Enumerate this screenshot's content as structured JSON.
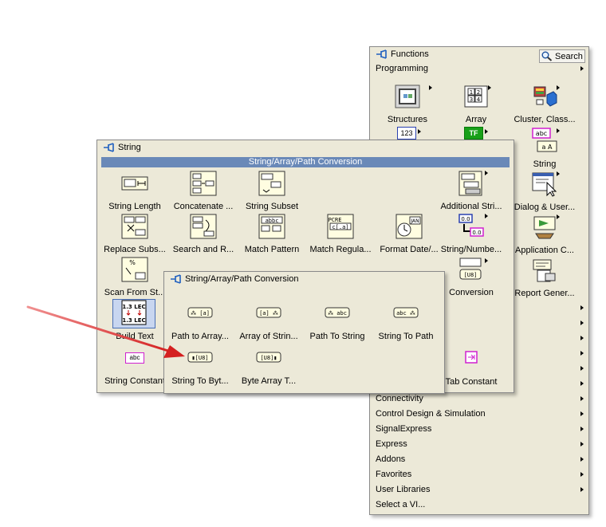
{
  "functions_palette": {
    "title": "Functions",
    "search_label": "Search",
    "category": "Programming",
    "icons": [
      {
        "label": "Structures"
      },
      {
        "label": "Array"
      },
      {
        "label": "Cluster, Class..."
      },
      {
        "label": "String"
      },
      {
        "label": "Dialog & User..."
      },
      {
        "label": "Application C..."
      },
      {
        "label": "Report Gener..."
      }
    ],
    "menu_items": [
      {
        "label": "Connectivity"
      },
      {
        "label": "Control Design & Simulation"
      },
      {
        "label": "SignalExpress"
      },
      {
        "label": "Express"
      },
      {
        "label": "Addons"
      },
      {
        "label": "Favorites"
      },
      {
        "label": "User Libraries"
      },
      {
        "label": "Select a VI..."
      }
    ]
  },
  "string_palette": {
    "title": "String",
    "section_header": "String/Array/Path Conversion",
    "icons": [
      {
        "label": "String Length"
      },
      {
        "label": "Concatenate ..."
      },
      {
        "label": "String Subset"
      },
      {
        "label": "Additional Stri..."
      },
      {
        "label": "Replace Subs..."
      },
      {
        "label": "Search and R..."
      },
      {
        "label": "Match Pattern"
      },
      {
        "label": "Match Regula..."
      },
      {
        "label": "Format Date/..."
      },
      {
        "label": "String/Numbe..."
      },
      {
        "label": "Scan From St..."
      },
      {
        "label": "Conversion"
      },
      {
        "label": "Build Text"
      },
      {
        "label": "String Constant"
      },
      {
        "label": "Tab Constant"
      }
    ]
  },
  "conversion_palette": {
    "title": "String/Array/Path Conversion",
    "icons": [
      {
        "label": "Path to Array..."
      },
      {
        "label": "Array of Strin..."
      },
      {
        "label": "Path To String"
      },
      {
        "label": "String To Path"
      },
      {
        "label": "String To Byt..."
      },
      {
        "label": "Byte Array T..."
      }
    ]
  },
  "icon_glyphs": {
    "string_constant": "abc",
    "string_number": "0.0",
    "build_text_top": "1.3 LEC",
    "build_text_bottom": "1.3 LEC",
    "array_cells": "1 2 3 4",
    "tf": "TF",
    "num": "123",
    "string_abc": "abc"
  },
  "colors": {
    "accent_band": "#6a89b8",
    "annotation_arrow": "#d42020",
    "panel_bg": "#ece9d8"
  }
}
